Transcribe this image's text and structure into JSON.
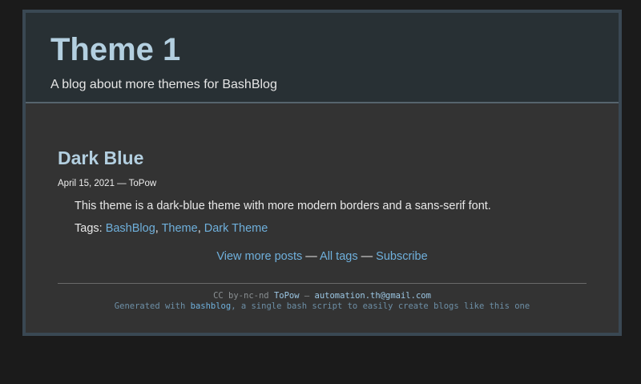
{
  "header": {
    "title": "Theme 1",
    "subtitle": "A blog about more themes for BashBlog"
  },
  "post": {
    "title": "Dark Blue",
    "date": "April 15, 2021",
    "meta_separator": " — ",
    "author": "ToPow",
    "body": "This theme is a dark-blue theme with more modern borders and a sans-serif font.",
    "tags_label": "Tags: ",
    "tags": [
      "BashBlog",
      "Theme",
      "Dark Theme"
    ],
    "tag_separator": ", "
  },
  "nav": {
    "view_more": "View more posts",
    "separator": " — ",
    "all_tags": "All tags",
    "subscribe": "Subscribe"
  },
  "footer": {
    "license": "CC by-nc-nd ",
    "author_link": "ToPow",
    "dash": " — ",
    "email": "automation.th@gmail.com",
    "generated_prefix": "Generated with ",
    "bashblog_link": "bashblog",
    "generated_suffix": ", a single bash script to easily create blogs like this one"
  }
}
